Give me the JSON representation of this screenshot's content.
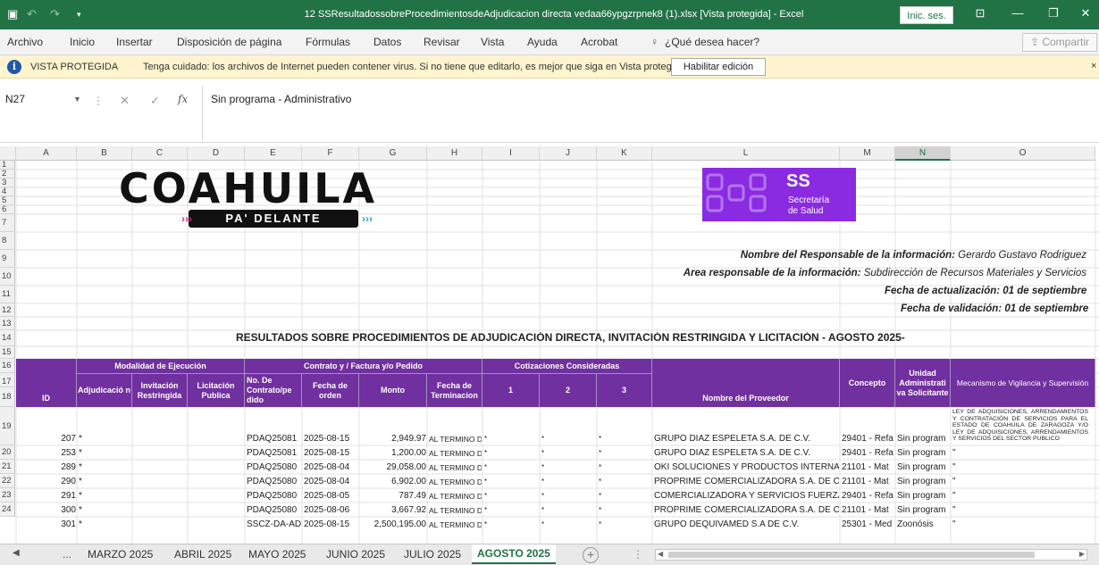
{
  "titlebar": {
    "title": "12 SSResultadossobreProcedimientosdeAdjudicacion directa vedaa66ypgzrpnek8 (1).xlsx  [Vista protegida]  -  Excel",
    "signin_label": "Inic. ses.",
    "save_icon": "▣",
    "undo_icon": "↶",
    "redo_icon": "↷",
    "customize_icon": "▾",
    "ribbon_options_icon": "⊡",
    "minimize_icon": "—",
    "restore_icon": "❐",
    "close_icon": "✕"
  },
  "ribbon": {
    "tabs": [
      "Archivo",
      "Inicio",
      "Insertar",
      "Disposición de página",
      "Fórmulas",
      "Datos",
      "Revisar",
      "Vista",
      "Ayuda",
      "Acrobat"
    ],
    "tell_me_icon": "♀",
    "tell_me": "¿Qué desea hacer?",
    "share_label": "⇪ Compartir"
  },
  "protected_view": {
    "icon": "i",
    "title": "VISTA PROTEGIDA",
    "message": "Tenga cuidado: los archivos de Internet pueden contener virus. Si no tiene que editarlo, es mejor que siga en Vista protegida.",
    "enable_button": "Habilitar edición",
    "close_icon": "×"
  },
  "formula_bar": {
    "name_box": "N27",
    "name_box_arrow": "▼",
    "dots": "⋮",
    "cancel_icon": "✕",
    "enter_icon": "✓",
    "fx_label": "fx",
    "value": "Sin programa - Administrativo"
  },
  "columns": [
    {
      "letter": "A",
      "active": false
    },
    {
      "letter": "B",
      "active": false
    },
    {
      "letter": "C",
      "active": false
    },
    {
      "letter": "D",
      "active": false
    },
    {
      "letter": "E",
      "active": false
    },
    {
      "letter": "F",
      "active": false
    },
    {
      "letter": "G",
      "active": false
    },
    {
      "letter": "H",
      "active": false
    },
    {
      "letter": "I",
      "active": false
    },
    {
      "letter": "J",
      "active": false
    },
    {
      "letter": "K",
      "active": false
    },
    {
      "letter": "L",
      "active": false
    },
    {
      "letter": "M",
      "active": false
    },
    {
      "letter": "N",
      "active": true
    },
    {
      "letter": "O",
      "active": false
    }
  ],
  "rows": [
    "1",
    "2",
    "3",
    "4",
    "5",
    "6",
    "7",
    "8",
    "9",
    "10",
    "11",
    "12",
    "13",
    "14",
    "15",
    "16",
    "17",
    "18",
    "19",
    "20",
    "21",
    "22",
    "23",
    "24"
  ],
  "logos": {
    "coahuila": "COAHUILA",
    "coahuila_tagline": "PA' DELANTE",
    "salud_mark": "SS",
    "salud_line1": "Secretaría",
    "salud_line2": "de Salud"
  },
  "info": {
    "responsable_label": "Nombre del Responsable de la información:",
    "responsable_value": "Gerardo Gustavo Rodriguez",
    "area_label": "Área responsable de la información:",
    "area_value": "Subdirección de Recursos Materiales y Servicios",
    "fecha_act": "Fecha de actualización: 01 de septiembre",
    "fecha_val": "Fecha de validación: 01 de septiembre"
  },
  "report_title": "RESULTADOS SOBRE PROCEDIMIENTOS DE ADJUDICACIÓN DIRECTA, INVITACIÓN RESTRINGIDA Y LICITACIÓN   - AGOSTO 2025-",
  "headers": {
    "id": "ID",
    "modalidad": "Modalidad de Ejecución",
    "adjudicacion": "Adjudicació n",
    "invitacion": "Invitación Restringida",
    "licitacion": "Licitación Publica",
    "contrato": "Contrato y / Factura y/o Pedido",
    "no_contrato": "No. De Contrato/pe dido",
    "fecha_orden": "Fecha de orden",
    "monto": "Monto",
    "fecha_term": "Fecha de Terminacion",
    "cotizaciones": "Cotizaciones Consideradas",
    "cot1": "1",
    "cot2": "2",
    "cot3": "3",
    "proveedor": "Nombre del Proveedor",
    "concepto": "Concepto",
    "unidad": "Unidad Administrati va Solicitante",
    "mecanismo": "Mecanismo de Vigilancia y Supervisión"
  },
  "mecanismo_text": "LEY DE ADQUISICIONES, ARRENDAMIENTOS Y CONTRATACIÓN DE SERVICIOS PARA EL ESTADO DE COAHUILA DE ZARAGOZA Y/O LEY DE ADQUISICIONES, ARRENDAMIENTOS Y SERVICIOS DEL SECTOR PUBLICO",
  "table_rows": [
    {
      "id": "207",
      "adj": "*",
      "contrato": "PDAQ25081",
      "fecha": "2025-08-15",
      "monto": "2,949.97",
      "term": "AL TERMINO D",
      "c1": "*",
      "c2": "*",
      "c3": "*",
      "proveedor": "GRUPO DIAZ ESPELETA S.A. DE C.V.",
      "concepto": "29401 - Refa",
      "unidad": "Sin program",
      "mec": ""
    },
    {
      "id": "253",
      "adj": "*",
      "contrato": "PDAQ25081",
      "fecha": "2025-08-15",
      "monto": "1,200.00",
      "term": "AL TERMINO D",
      "c1": "*",
      "c2": "*",
      "c3": "*",
      "proveedor": "GRUPO DIAZ ESPELETA S.A. DE C.V.",
      "concepto": "29401 - Refa",
      "unidad": "Sin program",
      "mec": "\""
    },
    {
      "id": "289",
      "adj": "*",
      "contrato": "PDAQ25080",
      "fecha": "2025-08-04",
      "monto": "29,058.00",
      "term": "AL TERMINO D",
      "c1": "*",
      "c2": "*",
      "c3": "*",
      "proveedor": "OKI SOLUCIONES Y PRODUCTOS INTERNAC",
      "concepto": "21101 - Mat",
      "unidad": "Sin program",
      "mec": "\""
    },
    {
      "id": "290",
      "adj": "*",
      "contrato": "PDAQ25080",
      "fecha": "2025-08-04",
      "monto": "6,902.00",
      "term": "AL TERMINO D",
      "c1": "*",
      "c2": "*",
      "c3": "*",
      "proveedor": "PROPRIME COMERCIALIZADORA S.A. DE C.V",
      "concepto": "21101 - Mat",
      "unidad": "Sin program",
      "mec": "\""
    },
    {
      "id": "291",
      "adj": "*",
      "contrato": "PDAQ25080",
      "fecha": "2025-08-05",
      "monto": "787.49",
      "term": "AL TERMINO D",
      "c1": "*",
      "c2": "*",
      "c3": "*",
      "proveedor": "COMERCIALIZADORA Y SERVICIOS FUERZA",
      "concepto": "29401 - Refa",
      "unidad": "Sin program",
      "mec": "\""
    },
    {
      "id": "300",
      "adj": "*",
      "contrato": "PDAQ25080",
      "fecha": "2025-08-06",
      "monto": "3,667.92",
      "term": "AL TERMINO D",
      "c1": "*",
      "c2": "*",
      "c3": "*",
      "proveedor": "PROPRIME COMERCIALIZADORA S.A. DE C.V",
      "concepto": "21101 - Mat",
      "unidad": "Sin program",
      "mec": "\""
    },
    {
      "id": "301",
      "adj": "*",
      "contrato": "SSCZ-DA-AD-",
      "fecha": "2025-08-15",
      "monto": "2,500,195.00",
      "term": "AL TERMINO D",
      "c1": "*",
      "c2": "*",
      "c3": "*",
      "proveedor": "GRUPO DEQUIVAMED S.A DE C.V.",
      "concepto": "25301 - Med",
      "unidad": "Zoonósis",
      "mec": "\""
    }
  ],
  "sheet_tabs": {
    "nav_left": "◀",
    "nav_right": "▶",
    "more": "...",
    "tabs": [
      "MARZO 2025",
      "ABRIL 2025",
      "MAYO 2025",
      "JUNIO 2025",
      "JULIO 2025",
      "AGOSTO 2025"
    ],
    "add_icon": "+",
    "dots": "⋮",
    "scroll_left": "◀",
    "scroll_right": "▶"
  }
}
